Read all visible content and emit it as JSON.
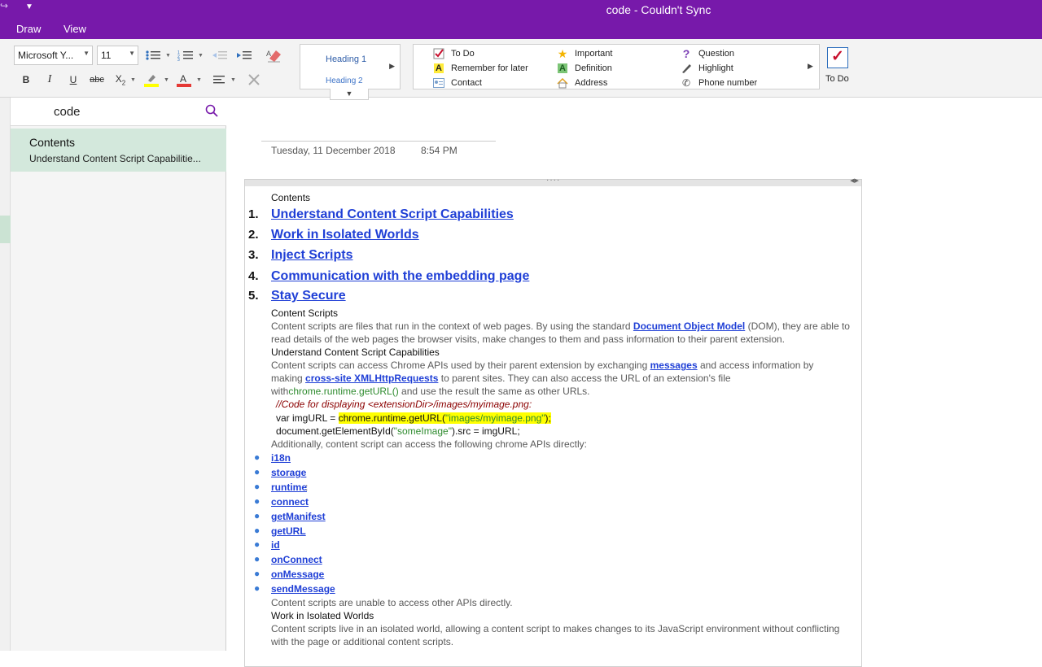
{
  "window": {
    "title": "code - Couldn't Sync"
  },
  "menu": {
    "draw": "Draw",
    "view": "View"
  },
  "ribbon": {
    "font_name": "Microsoft Y...",
    "font_size": "11",
    "styles": {
      "heading1": "Heading 1",
      "heading2": "Heading 2"
    },
    "tags": [
      {
        "label": "To Do",
        "icon": "checkbox-icon"
      },
      {
        "label": "Remember for later",
        "icon": "highlight-a-icon"
      },
      {
        "label": "Contact",
        "icon": "contact-card-icon"
      },
      {
        "label": "Important",
        "icon": "star-icon"
      },
      {
        "label": "Definition",
        "icon": "definition-a-icon"
      },
      {
        "label": "Address",
        "icon": "house-icon"
      },
      {
        "label": "Question",
        "icon": "question-icon"
      },
      {
        "label": "Highlight",
        "icon": "pen-icon"
      },
      {
        "label": "Phone number",
        "icon": "phone-icon"
      }
    ],
    "todo_button": "To Do"
  },
  "sidebar": {
    "search_query": "code",
    "page": {
      "title": "Contents",
      "snippet": "Understand Content Script Capabilitie..."
    }
  },
  "note": {
    "date": "Tuesday, 11 December 2018",
    "time": "8:54 PM",
    "contents_label": "Contents",
    "toc": [
      {
        "n": "1.",
        "t": "Understand Content Script Capabilities"
      },
      {
        "n": "2.",
        "t": "Work in Isolated Worlds"
      },
      {
        "n": "3.",
        "t": "Inject Scripts"
      },
      {
        "n": "4.",
        "t": "Communication with the embedding page"
      },
      {
        "n": "5.",
        "t": "Stay Secure"
      }
    ],
    "h_content_scripts": "Content Scripts",
    "p1a": "Content scripts are files that run in the context of web pages. By using the standard ",
    "p1_link": "Document Object Model",
    "p1b": " (DOM), they are able to",
    "p1c": "read details of the web pages the browser visits, make changes to them and pass information to their parent extension.",
    "h_understand": "Understand Content Script Capabilities",
    "p2a": "Content scripts can access Chrome APIs used by their parent extension by exchanging ",
    "p2_link": "messages",
    "p2b": " and access information by",
    "p2c": "making ",
    "p2_link2": "cross-site XMLHttpRequests",
    "p2d": " to parent sites. They can also access the URL of an extension's file",
    "p2e": "with",
    "p2_code": "chrome.runtime.getURL()",
    "p2f": " and use the result the same as other URLs.",
    "code1": "//Code for displaying <extensionDir>/images/myimage.png:",
    "code2a": "var imgURL = ",
    "code2b": "chrome.runtime.getURL(",
    "code2c": "\"images/myimage.png\"",
    "code2d": ");",
    "code3a": "document.getElementById(",
    "code3b": "\"someImage\"",
    "code3c": ").src = imgURL;",
    "p3": "Additionally, content script can access the following chrome APIs directly:",
    "apis": [
      "i18n",
      "storage",
      "runtime",
      "connect",
      "getManifest",
      "getURL",
      "id",
      "onConnect",
      "onMessage",
      "sendMessage"
    ],
    "runtime_suffix": ":",
    "p4": "Content scripts are unable to access other APIs directly.",
    "h_isolated": "Work in Isolated Worlds",
    "p5a": "Content scripts live in an isolated world, allowing a content script to makes changes to its JavaScript environment without conflicting",
    "p5b": "with the page or additional content scripts."
  },
  "colors": {
    "accent": "#7719aa",
    "link": "#1f3fd6",
    "selected_page": "#d3e8dc"
  }
}
